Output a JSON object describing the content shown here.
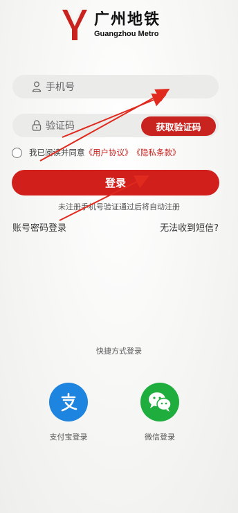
{
  "brand": {
    "name_cn": "广州地铁",
    "name_en": "Guangzhou Metro"
  },
  "form": {
    "phone_placeholder": "手机号",
    "code_placeholder": "验证码",
    "get_code_button": "获取验证码",
    "agreement_prefix": "我已阅读并同意",
    "user_agreement": "《用户协议》",
    "privacy_policy": "《隐私条款》",
    "login_button": "登录",
    "auto_register_hint": "未注册手机号验证通过后将自动注册"
  },
  "links": {
    "password_login": "账号密码登录",
    "cannot_receive_sms": "无法收到短信?"
  },
  "quick_login": {
    "title": "快捷方式登录",
    "alipay_label": "支付宝登录",
    "wechat_label": "微信登录"
  },
  "colors": {
    "accent": "#d1201c",
    "alipay": "#1d84e0",
    "wechat": "#1fae3d"
  }
}
